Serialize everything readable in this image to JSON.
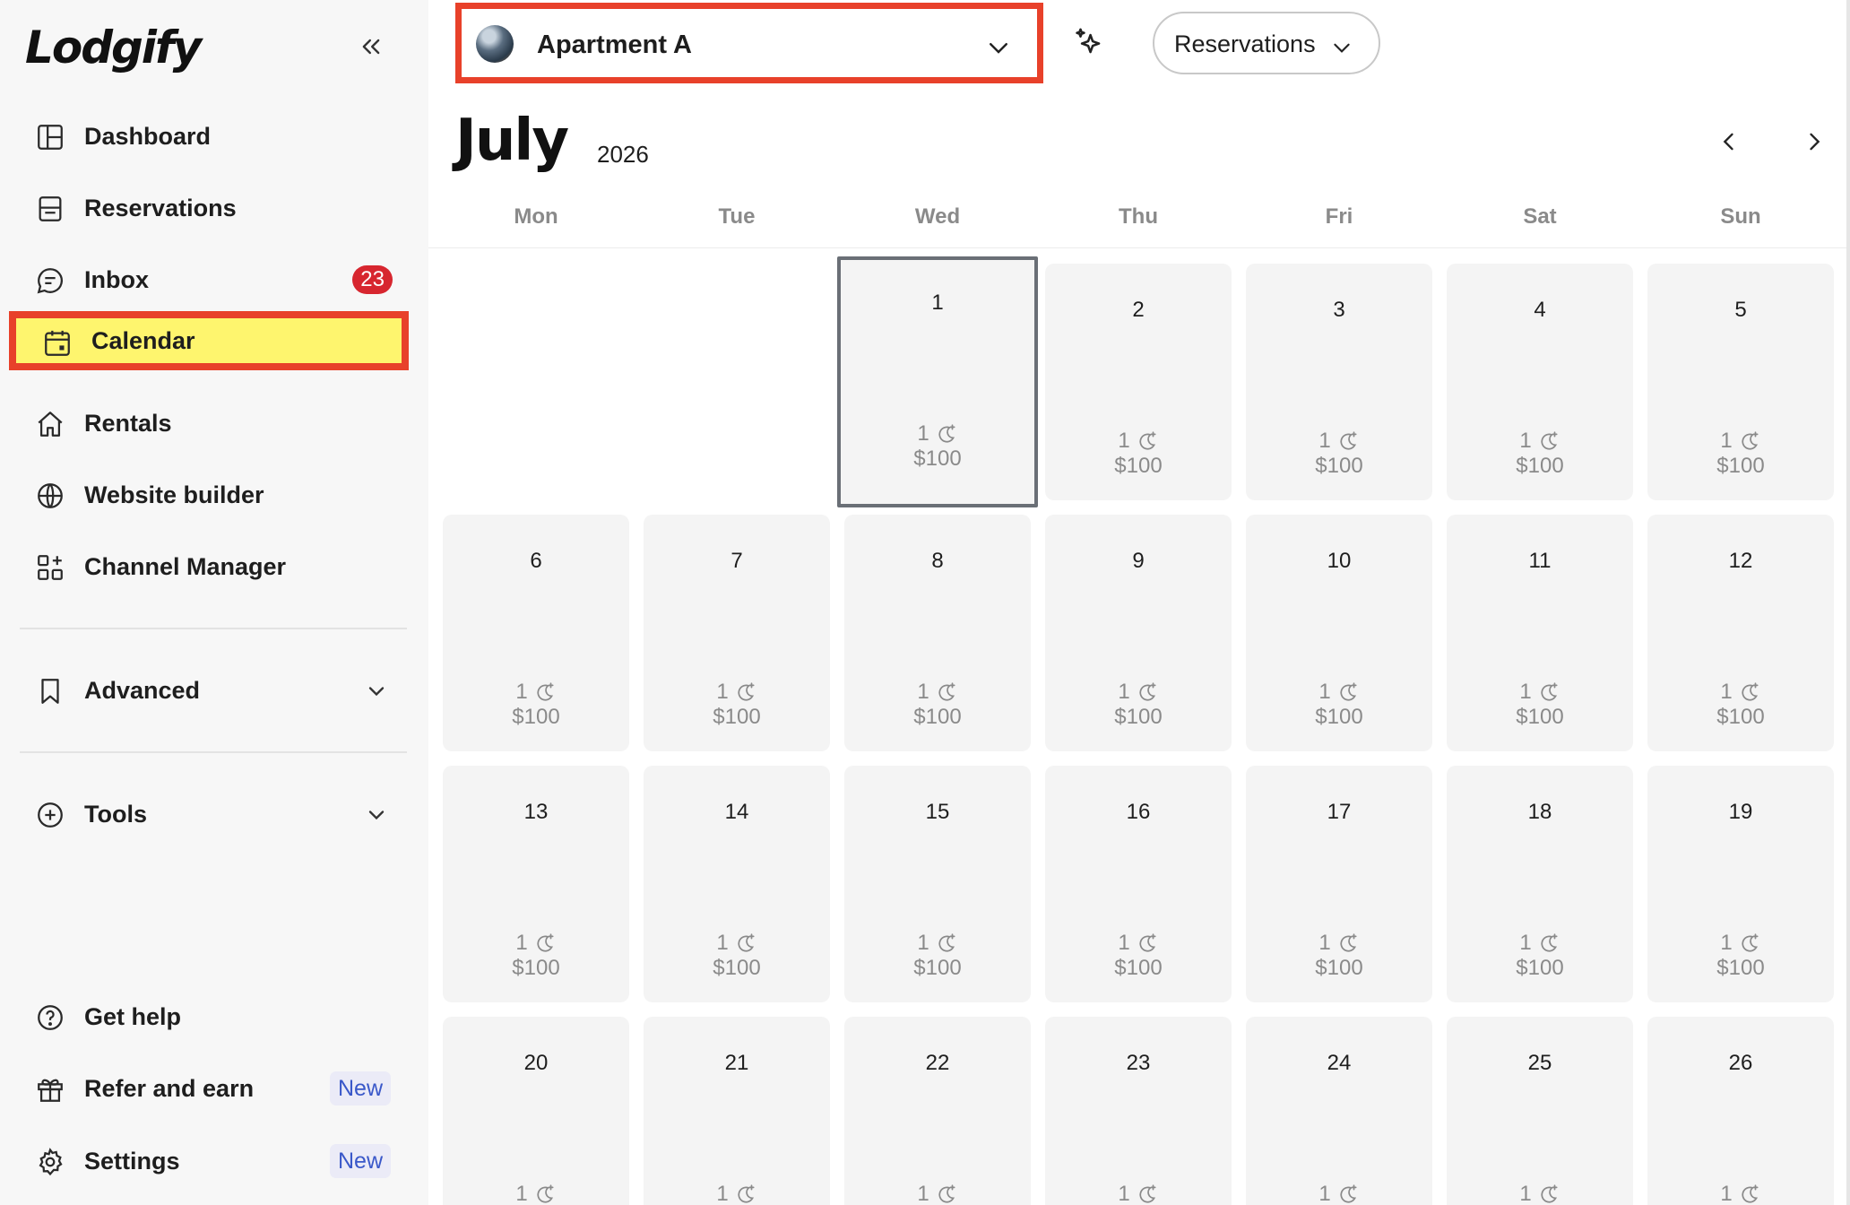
{
  "brand": {
    "logo_text": "Lodgify"
  },
  "sidebar": {
    "collapse_icon": "double-chevron-left-icon",
    "items": [
      {
        "label": "Dashboard",
        "icon": "dashboard-icon"
      },
      {
        "label": "Reservations",
        "icon": "reservations-icon"
      },
      {
        "label": "Inbox",
        "icon": "inbox-icon",
        "badge": "23"
      },
      {
        "label": "Calendar",
        "icon": "calendar-icon",
        "active": true
      },
      {
        "label": "Rentals",
        "icon": "home-icon"
      },
      {
        "label": "Website builder",
        "icon": "globe-icon"
      },
      {
        "label": "Channel Manager",
        "icon": "channel-manager-icon"
      }
    ],
    "advanced_label": "Advanced",
    "tools_label": "Tools",
    "bottom_items": [
      {
        "label": "Get help",
        "icon": "help-icon"
      },
      {
        "label": "Refer and earn",
        "icon": "gift-icon",
        "badge": "New"
      },
      {
        "label": "Settings",
        "icon": "gear-icon",
        "badge": "New"
      }
    ]
  },
  "header": {
    "property_name": "Apartment A",
    "view_dropdown_label": "Reservations"
  },
  "calendar": {
    "month": "July",
    "year": "2026",
    "weekdays": [
      "Mon",
      "Tue",
      "Wed",
      "Thu",
      "Fri",
      "Sat",
      "Sun"
    ],
    "days": [
      {
        "day": "1",
        "nights": "1",
        "price": "$100",
        "today": true
      },
      {
        "day": "2",
        "nights": "1",
        "price": "$100"
      },
      {
        "day": "3",
        "nights": "1",
        "price": "$100"
      },
      {
        "day": "4",
        "nights": "1",
        "price": "$100"
      },
      {
        "day": "5",
        "nights": "1",
        "price": "$100"
      },
      {
        "day": "6",
        "nights": "1",
        "price": "$100"
      },
      {
        "day": "7",
        "nights": "1",
        "price": "$100"
      },
      {
        "day": "8",
        "nights": "1",
        "price": "$100"
      },
      {
        "day": "9",
        "nights": "1",
        "price": "$100"
      },
      {
        "day": "10",
        "nights": "1",
        "price": "$100"
      },
      {
        "day": "11",
        "nights": "1",
        "price": "$100"
      },
      {
        "day": "12",
        "nights": "1",
        "price": "$100"
      },
      {
        "day": "13",
        "nights": "1",
        "price": "$100"
      },
      {
        "day": "14",
        "nights": "1",
        "price": "$100"
      },
      {
        "day": "15",
        "nights": "1",
        "price": "$100"
      },
      {
        "day": "16",
        "nights": "1",
        "price": "$100"
      },
      {
        "day": "17",
        "nights": "1",
        "price": "$100"
      },
      {
        "day": "18",
        "nights": "1",
        "price": "$100"
      },
      {
        "day": "19",
        "nights": "1",
        "price": "$100"
      },
      {
        "day": "20",
        "nights": "1",
        "price": ""
      },
      {
        "day": "21",
        "nights": "1",
        "price": ""
      },
      {
        "day": "22",
        "nights": "1",
        "price": ""
      },
      {
        "day": "23",
        "nights": "1",
        "price": ""
      },
      {
        "day": "24",
        "nights": "1",
        "price": ""
      },
      {
        "day": "25",
        "nights": "1",
        "price": ""
      },
      {
        "day": "26",
        "nights": "1",
        "price": ""
      }
    ]
  },
  "colors": {
    "highlight": "#e8412a",
    "active_bg": "#fef56e",
    "badge_red": "#d7262f",
    "new_badge_text": "#3a58c9"
  }
}
